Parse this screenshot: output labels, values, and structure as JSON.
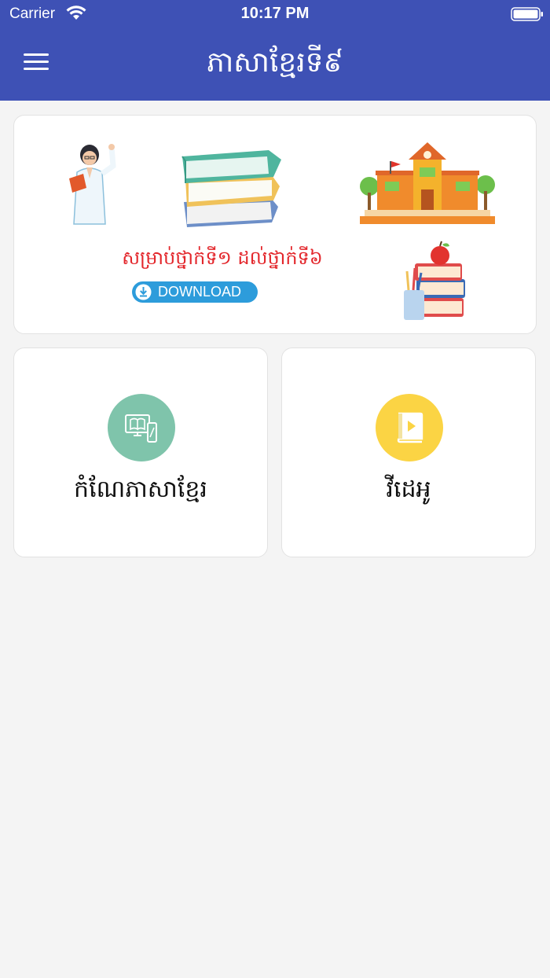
{
  "status_bar": {
    "carrier": "Carrier",
    "time": "10:17 PM"
  },
  "header": {
    "title": "ភាសាខ្មែរទី៩",
    "menu_icon": "hamburger-menu-icon"
  },
  "banner": {
    "text": "សម្រាប់ថ្នាក់ទី១ ដល់ថ្នាក់ទី៦",
    "download_label": "DOWNLOAD",
    "text_color": "#e3262b",
    "button_color": "#2d9cdb"
  },
  "cards": [
    {
      "label": "កំណែភាសាខ្មែរ",
      "icon": "book-tablet-icon",
      "color": "#7fc4ab"
    },
    {
      "label": "វីដេអូ",
      "icon": "video-book-icon",
      "color": "#fbd444"
    }
  ],
  "theme": {
    "primary": "#3e51b5",
    "background": "#f4f4f4"
  }
}
